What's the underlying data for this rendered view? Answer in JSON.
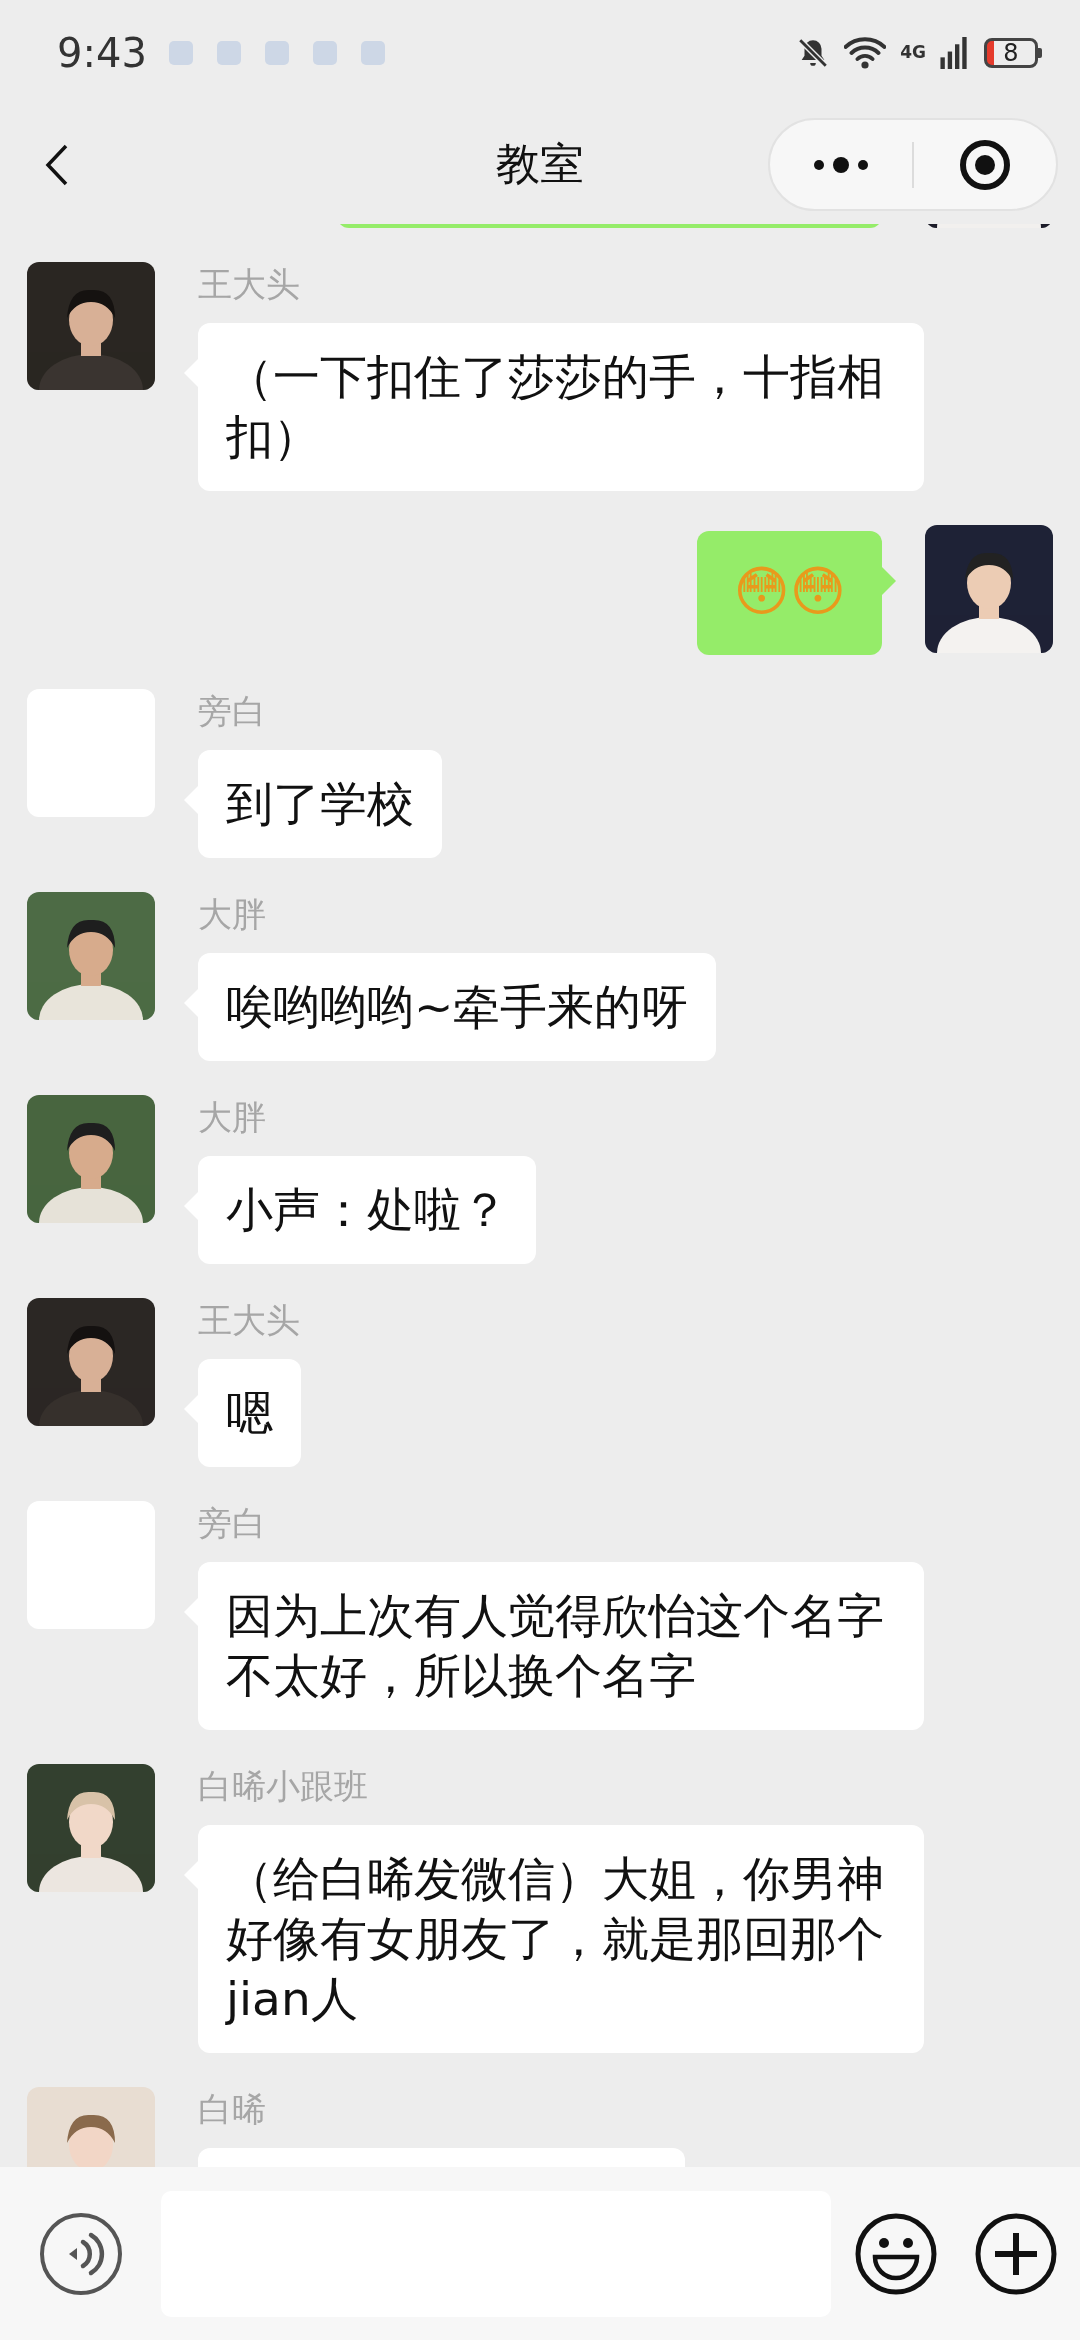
{
  "status_bar": {
    "time": "9:43",
    "network": "4G",
    "battery": "8"
  },
  "header": {
    "title": "教室"
  },
  "messages": [
    {
      "kind": "sent"
    },
    {
      "kind": "received",
      "sender": "王大头",
      "text": "（一下扣住了莎莎的手，十指相扣）"
    },
    {
      "kind": "sent",
      "text": "😳😳"
    },
    {
      "kind": "received",
      "sender": "旁白",
      "text": "到了学校",
      "avatar": {
        "kind": "blank"
      }
    },
    {
      "kind": "received",
      "sender": "大胖",
      "text": "唉哟哟哟~牵手来的呀"
    },
    {
      "kind": "received",
      "sender": "大胖",
      "text": "小声：处啦？"
    },
    {
      "kind": "received",
      "sender": "王大头",
      "text": "嗯"
    },
    {
      "kind": "received",
      "sender": "旁白",
      "text": "因为上次有人觉得欣怡这个名字不太好，所以换个名字",
      "avatar": {
        "kind": "blank"
      }
    },
    {
      "kind": "received",
      "sender": "白晞小跟班",
      "text": "（给白晞发微信）大姐，你男神好像有女朋友了，就是那回那个jian人"
    },
    {
      "kind": "received",
      "sender": "白晞"
    }
  ],
  "input_bar": {
    "kind": "text"
  }
}
